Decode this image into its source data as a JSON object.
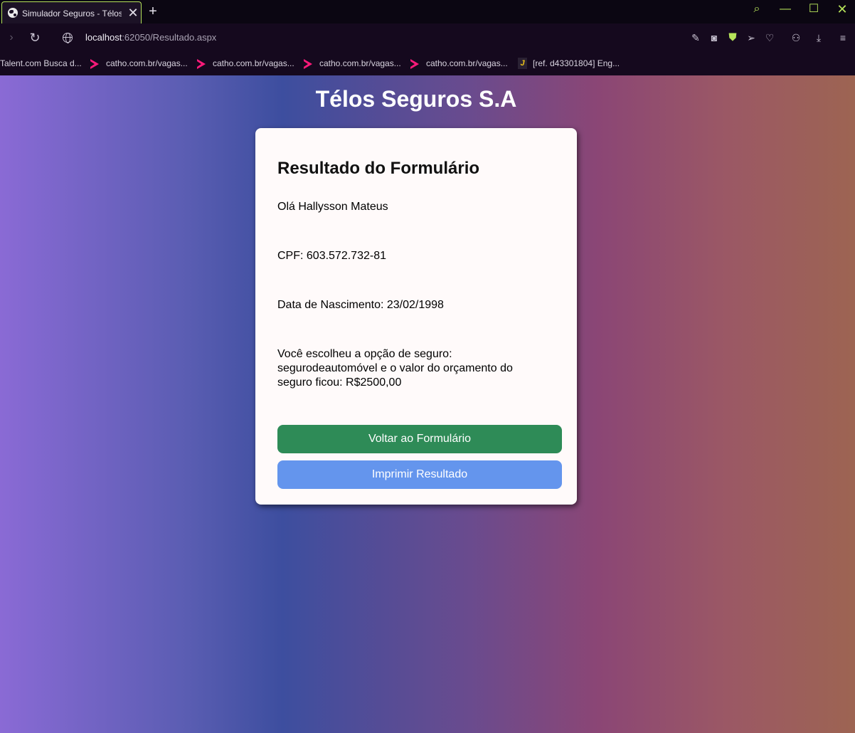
{
  "browser": {
    "tab_title": "Simulador Seguros - Télos",
    "tab_close": "✕",
    "new_tab": "+",
    "url_host": "localhost",
    "url_path": ":62050/Resultado.aspx",
    "bookmarks": [
      {
        "label": "Talent.com Busca d...",
        "icon": "none"
      },
      {
        "label": "catho.com.br/vagas...",
        "icon": "catho-chevron-icon"
      },
      {
        "label": "catho.com.br/vagas...",
        "icon": "catho-chevron-icon"
      },
      {
        "label": "catho.com.br/vagas...",
        "icon": "catho-chevron-icon"
      },
      {
        "label": "catho.com.br/vagas...",
        "icon": "catho-chevron-icon"
      },
      {
        "label": "[ref. d43301804] Eng...",
        "icon": "j-icon"
      }
    ],
    "accent_color": "#b6e35a"
  },
  "page": {
    "brand_title": "Télos Seguros S.A",
    "card_title": "Resultado do Formulário",
    "greeting": "Olá Hallysson Mateus",
    "cpf": "CPF: 603.572.732-81",
    "birth_date": "Data de Nascimento: 23/02/1998",
    "result_text": "Você escolheu a opção de seguro: segurodeautomóvel e o valor do orçamento do seguro ficou: R$2500,00",
    "back_button": "Voltar ao Formulário",
    "print_button": "Imprimir Resultado",
    "colors": {
      "back_button": "#2e8b57",
      "print_button": "#6495ed",
      "card_background": "#fffafa"
    }
  }
}
